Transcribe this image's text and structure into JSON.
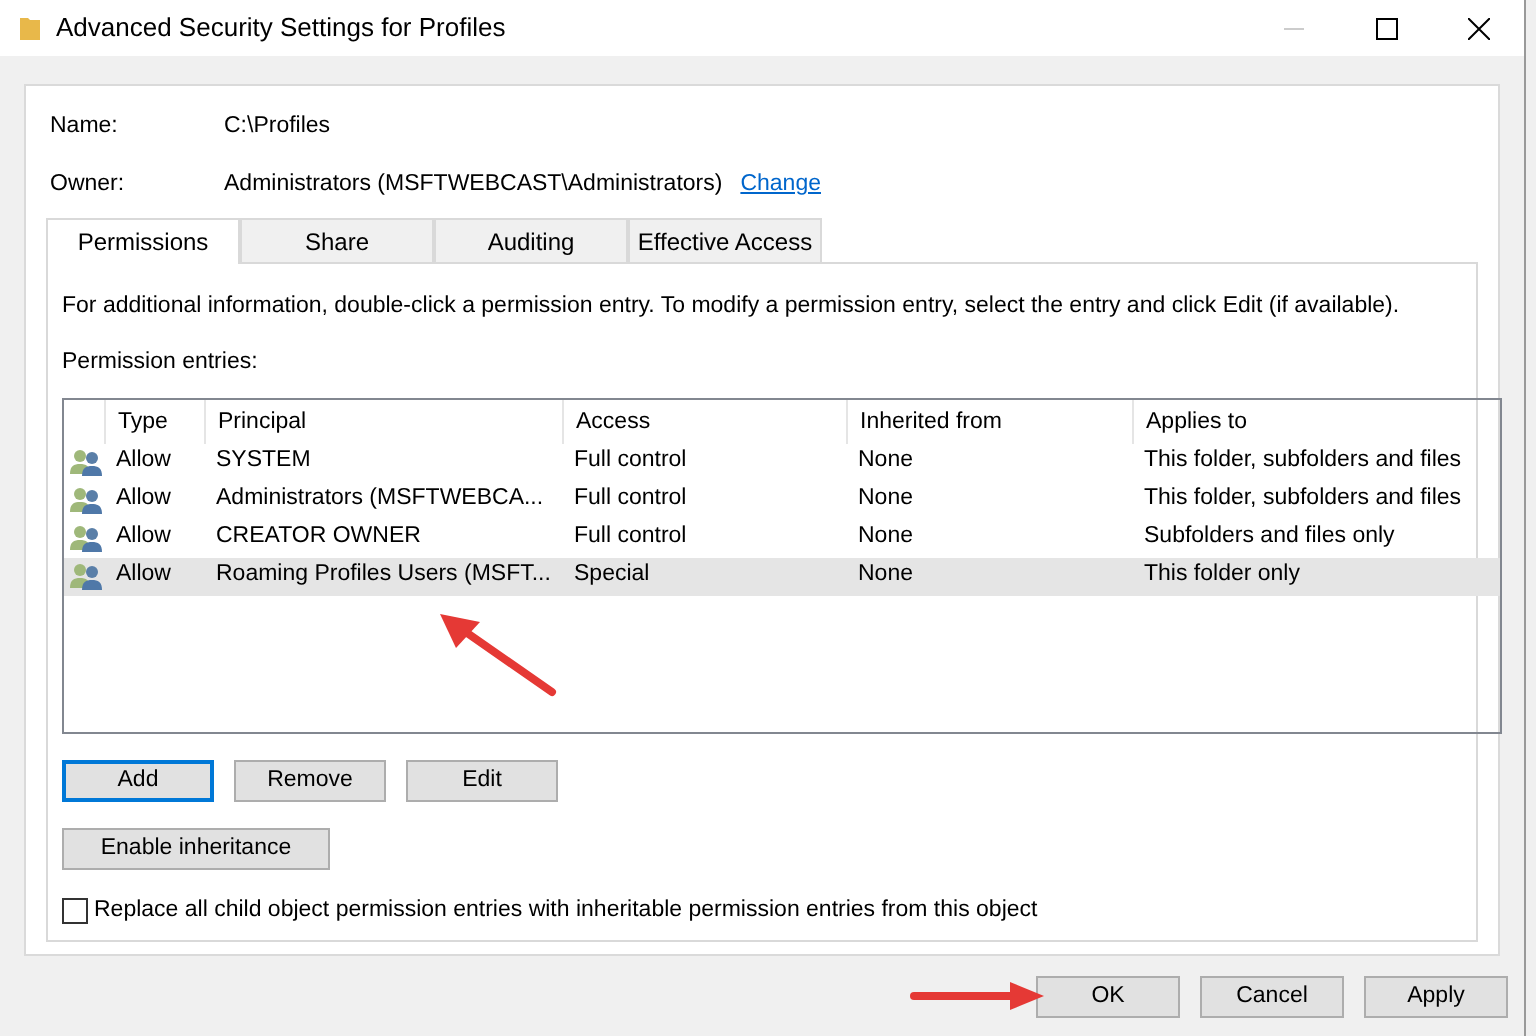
{
  "window": {
    "title": "Advanced Security Settings for Profiles"
  },
  "name_field": {
    "label": "Name:",
    "value": "C:\\Profiles"
  },
  "owner_field": {
    "label": "Owner:",
    "value": "Administrators (MSFTWEBCAST\\Administrators)",
    "link": "Change"
  },
  "tabs": [
    {
      "label": "Permissions",
      "selected": true
    },
    {
      "label": "Share",
      "selected": false
    },
    {
      "label": "Auditing",
      "selected": false
    },
    {
      "label": "Effective Access",
      "selected": false
    }
  ],
  "info_text": "For additional information, double-click a permission entry. To modify a permission entry, select the entry and click Edit (if available).",
  "entries_label": "Permission entries:",
  "table": {
    "columns": [
      "Type",
      "Principal",
      "Access",
      "Inherited from",
      "Applies to"
    ],
    "rows": [
      {
        "cells": [
          "Allow",
          "SYSTEM",
          "Full control",
          "None",
          "This folder, subfolders and files"
        ],
        "selected": false
      },
      {
        "cells": [
          "Allow",
          "Administrators (MSFTWEBCA...",
          "Full control",
          "None",
          "This folder, subfolders and files"
        ],
        "selected": false
      },
      {
        "cells": [
          "Allow",
          "CREATOR OWNER",
          "Full control",
          "None",
          "Subfolders and files only"
        ],
        "selected": false
      },
      {
        "cells": [
          "Allow",
          "Roaming Profiles Users (MSFT...",
          "Special",
          "None",
          "This folder only"
        ],
        "selected": true
      }
    ]
  },
  "entry_buttons": [
    {
      "label": "Add",
      "focused": true
    },
    {
      "label": "Remove",
      "focused": false
    },
    {
      "label": "Edit",
      "focused": false
    }
  ],
  "inheritance_button": "Enable inheritance",
  "replace_checkbox": {
    "label": "Replace all child object permission entries with inheritable permission entries from this object",
    "checked": false
  },
  "dialog_buttons": [
    "OK",
    "Cancel",
    "Apply"
  ]
}
